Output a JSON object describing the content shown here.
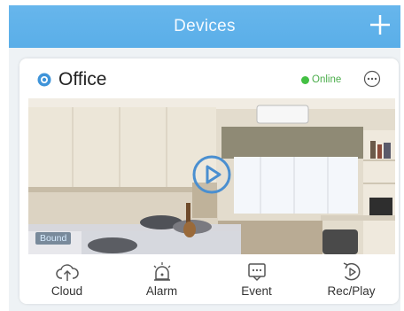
{
  "header": {
    "title": "Devices",
    "add_icon": "plus-icon"
  },
  "device": {
    "name": "Office",
    "status": "Online",
    "status_color": "#43c043",
    "badge": "Bound",
    "icons": {
      "camera": "camera-icon",
      "more": "more-options-icon",
      "play": "play-icon"
    }
  },
  "toolbar": {
    "items": [
      {
        "label": "Cloud",
        "icon": "cloud-upload-icon"
      },
      {
        "label": "Alarm",
        "icon": "alarm-icon"
      },
      {
        "label": "Event",
        "icon": "event-icon"
      },
      {
        "label": "Rec/Play",
        "icon": "rec-play-icon"
      }
    ]
  },
  "colors": {
    "header": "#5aaee8",
    "accent": "#5aa3e0",
    "online": "#43c043"
  }
}
